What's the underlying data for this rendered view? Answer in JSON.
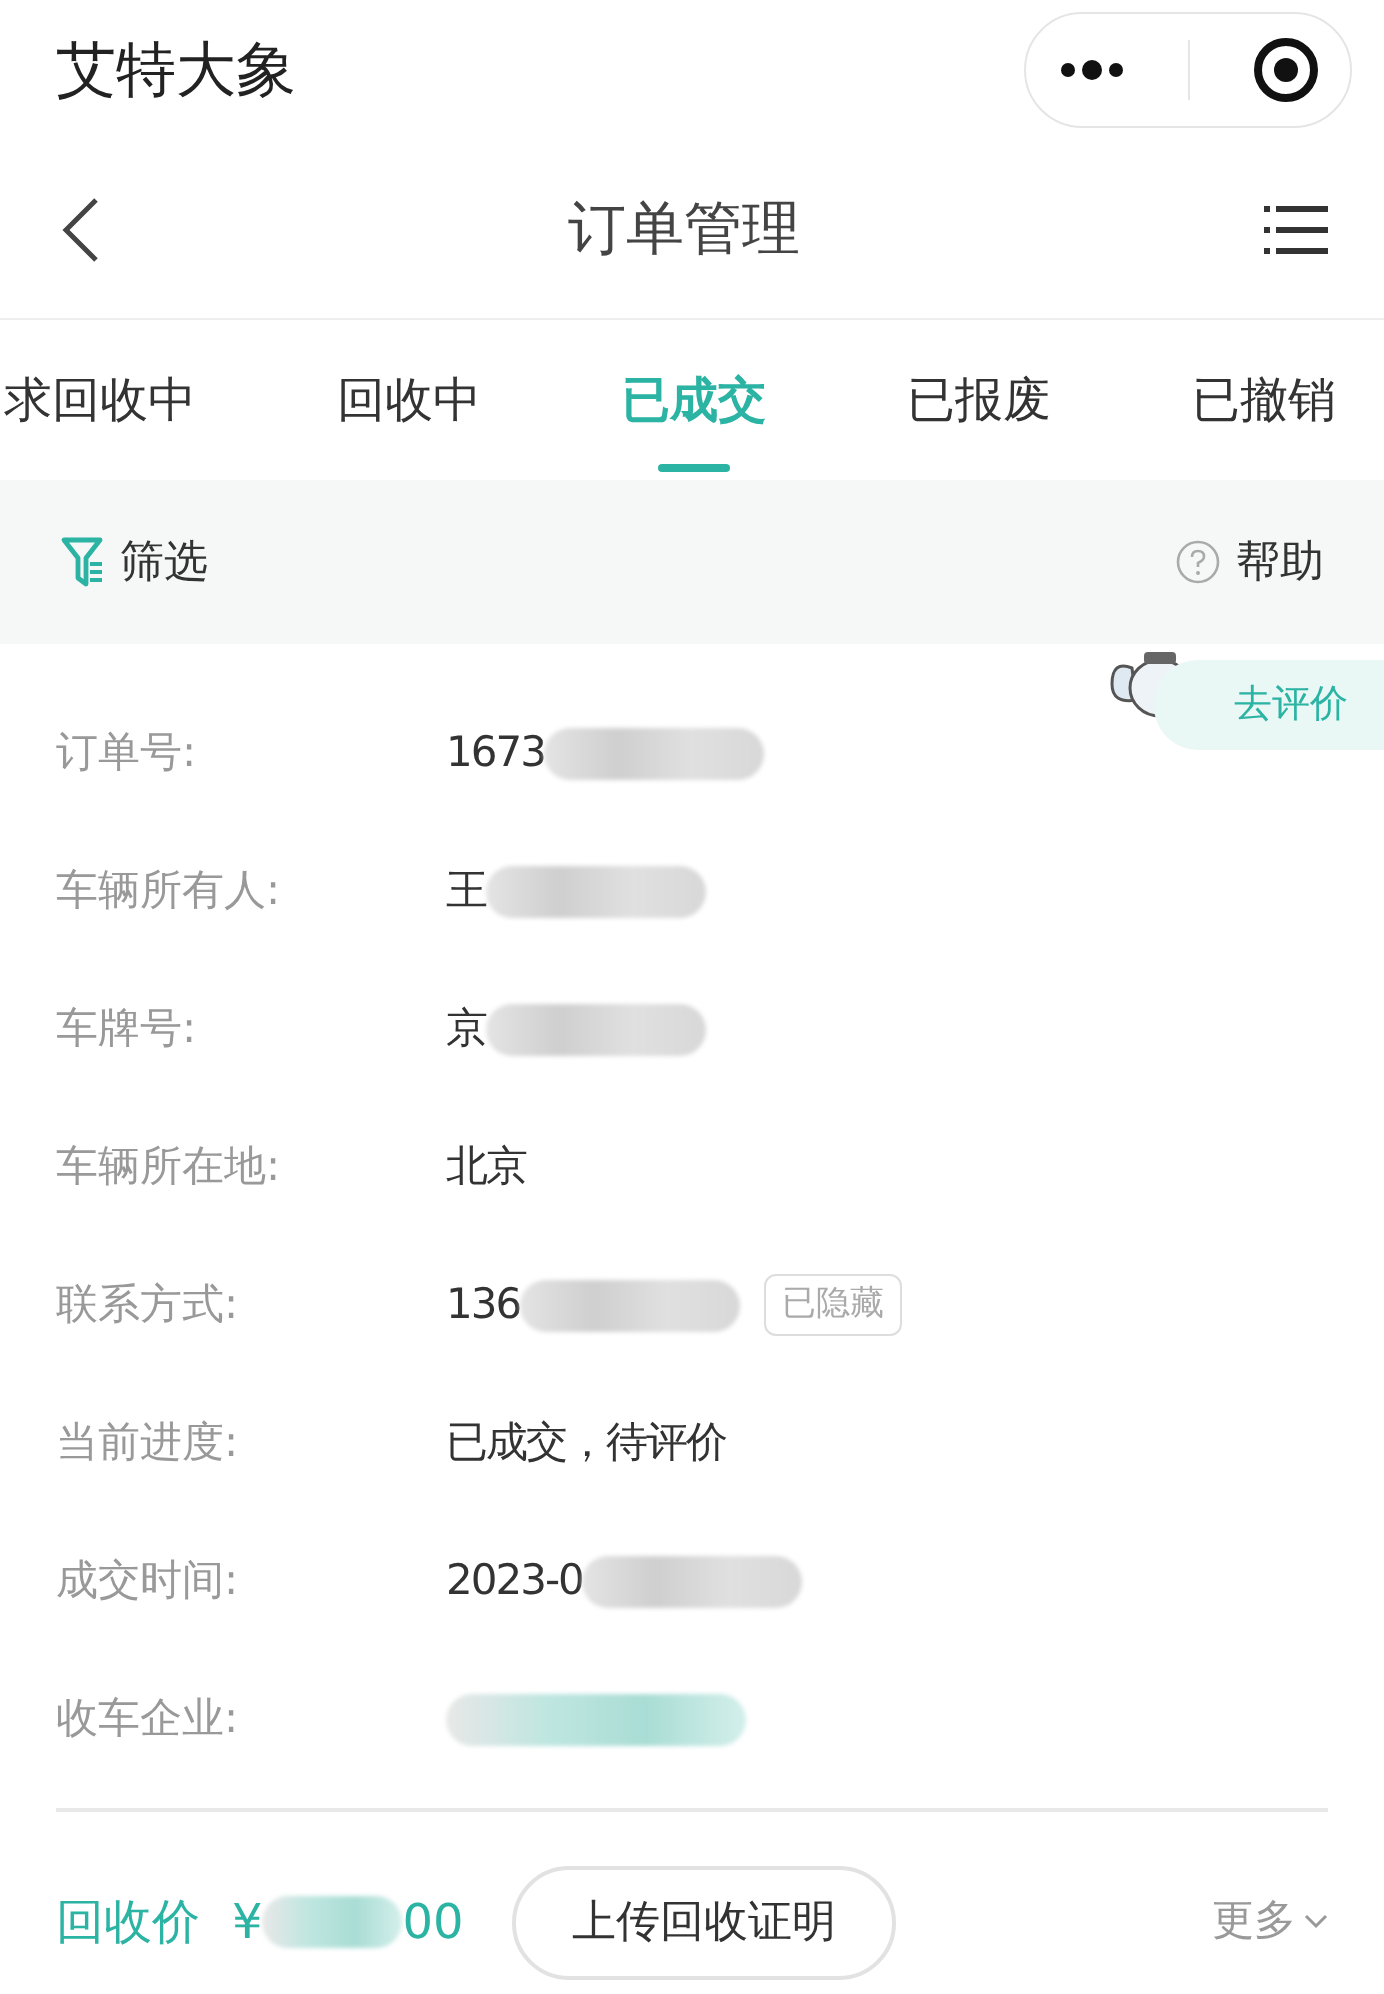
{
  "app_bar": {
    "title": "艾特大象"
  },
  "nav": {
    "title": "订单管理"
  },
  "tabs": [
    {
      "label": "求回收中",
      "selected": false
    },
    {
      "label": "回收中",
      "selected": false
    },
    {
      "label": "已成交",
      "selected": true
    },
    {
      "label": "已报废",
      "selected": false
    },
    {
      "label": "已撤销",
      "selected": false
    }
  ],
  "toolbar": {
    "filter": "筛选",
    "help": "帮助"
  },
  "order": {
    "action": "去评价",
    "fields": [
      {
        "label": "订单号:",
        "value": "1673",
        "masked": true
      },
      {
        "label": "车辆所有人:",
        "value": "王",
        "masked": true
      },
      {
        "label": "车牌号:",
        "value": "京",
        "masked": true
      },
      {
        "label": "车辆所在地:",
        "value": "北京",
        "masked": false
      },
      {
        "label": "联系方式:",
        "value": "136",
        "masked": true,
        "tag": "已隐藏"
      },
      {
        "label": "当前进度:",
        "value": "已成交，待评价",
        "masked": false
      },
      {
        "label": "成交时间:",
        "value": "2023-0",
        "masked": true
      },
      {
        "label": "收车企业:",
        "masked": true
      }
    ],
    "price": {
      "label": "回收价",
      "currency": "¥",
      "suffix": "00",
      "masked": true
    },
    "upload_button": "上传回收证明",
    "more": "更多"
  }
}
